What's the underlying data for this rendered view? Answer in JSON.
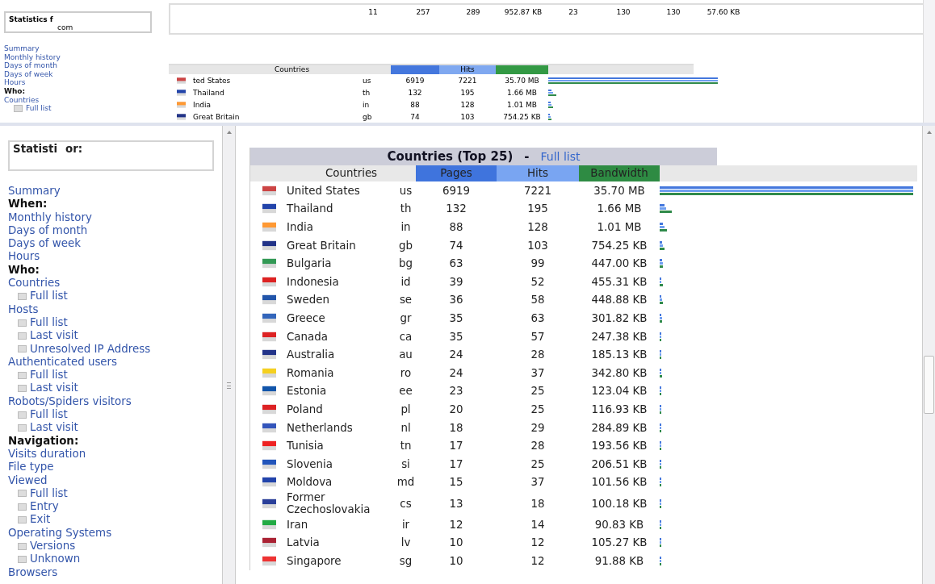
{
  "top_frame": {
    "stats_box": {
      "title": "Statistics f",
      "domain": "com"
    },
    "nav": [
      {
        "kind": "link",
        "label": "Summary"
      },
      {
        "kind": "link",
        "label": "Monthly history"
      },
      {
        "kind": "link",
        "label": "Days of month"
      },
      {
        "kind": "link",
        "label": "Days of week"
      },
      {
        "kind": "link",
        "label": "Hours"
      },
      {
        "kind": "heading",
        "label": "Who:"
      },
      {
        "kind": "link",
        "label": "Countries"
      },
      {
        "kind": "sub",
        "label": "Full list"
      }
    ],
    "summary_row": [
      "11",
      "257",
      "289",
      "952.87 KB",
      "23",
      "130",
      "130",
      "57.60 KB"
    ],
    "table": {
      "columns": [
        "Countries",
        "Hits"
      ],
      "rows": [
        {
          "name": "ted States",
          "code": "us",
          "pages": "6919",
          "hits": "7221",
          "bandwidth": "35.70 MB",
          "color": "#cc4444"
        },
        {
          "name": "Thailand",
          "code": "th",
          "pages": "132",
          "hits": "195",
          "bandwidth": "1.66 MB",
          "color": "#2244aa"
        },
        {
          "name": "India",
          "code": "in",
          "pages": "88",
          "hits": "128",
          "bandwidth": "1.01 MB",
          "color": "#ff9933"
        },
        {
          "name": "Great Britain",
          "code": "gb",
          "pages": "74",
          "hits": "103",
          "bandwidth": "754.25 KB",
          "color": "#223388"
        }
      ]
    }
  },
  "bottom_frame": {
    "stats_box": {
      "title": "Statisti",
      "title_end": "or:"
    },
    "nav": [
      {
        "kind": "link",
        "label": "Summary"
      },
      {
        "kind": "heading",
        "label": "When:"
      },
      {
        "kind": "link",
        "label": "Monthly history"
      },
      {
        "kind": "link",
        "label": "Days of month"
      },
      {
        "kind": "link",
        "label": "Days of week"
      },
      {
        "kind": "link",
        "label": "Hours"
      },
      {
        "kind": "heading",
        "label": "Who:"
      },
      {
        "kind": "link",
        "label": "Countries"
      },
      {
        "kind": "sub",
        "label": "Full list"
      },
      {
        "kind": "link",
        "label": "Hosts"
      },
      {
        "kind": "sub",
        "label": "Full list"
      },
      {
        "kind": "sub",
        "label": "Last visit"
      },
      {
        "kind": "sub",
        "label": "Unresolved IP Address"
      },
      {
        "kind": "link",
        "label": "Authenticated users"
      },
      {
        "kind": "sub",
        "label": "Full list"
      },
      {
        "kind": "sub",
        "label": "Last visit"
      },
      {
        "kind": "link",
        "label": "Robots/Spiders visitors"
      },
      {
        "kind": "sub",
        "label": "Full list"
      },
      {
        "kind": "sub",
        "label": "Last visit"
      },
      {
        "kind": "heading",
        "label": "Navigation:"
      },
      {
        "kind": "link",
        "label": "Visits duration"
      },
      {
        "kind": "link",
        "label": "File type"
      },
      {
        "kind": "link",
        "label": "Viewed"
      },
      {
        "kind": "sub",
        "label": "Full list"
      },
      {
        "kind": "sub",
        "label": "Entry"
      },
      {
        "kind": "sub",
        "label": "Exit"
      },
      {
        "kind": "link",
        "label": "Operating Systems"
      },
      {
        "kind": "sub",
        "label": "Versions"
      },
      {
        "kind": "sub",
        "label": "Unknown"
      },
      {
        "kind": "link",
        "label": "Browsers"
      }
    ],
    "table": {
      "title": "Countries (Top 25)",
      "separator": "-",
      "title_link": "Full list",
      "columns": [
        "Countries",
        "Pages",
        "Hits",
        "Bandwidth"
      ],
      "rows": [
        {
          "name": "United States",
          "code": "us",
          "pages": "6919",
          "hits": "7221",
          "bandwidth": "35.70 MB",
          "color": "#cc4444"
        },
        {
          "name": "Thailand",
          "code": "th",
          "pages": "132",
          "hits": "195",
          "bandwidth": "1.66 MB",
          "color": "#2244aa"
        },
        {
          "name": "India",
          "code": "in",
          "pages": "88",
          "hits": "128",
          "bandwidth": "1.01 MB",
          "color": "#ff9933"
        },
        {
          "name": "Great Britain",
          "code": "gb",
          "pages": "74",
          "hits": "103",
          "bandwidth": "754.25 KB",
          "color": "#223388"
        },
        {
          "name": "Bulgaria",
          "code": "bg",
          "pages": "63",
          "hits": "99",
          "bandwidth": "447.00 KB",
          "color": "#339955"
        },
        {
          "name": "Indonesia",
          "code": "id",
          "pages": "39",
          "hits": "52",
          "bandwidth": "455.31 KB",
          "color": "#dd2222"
        },
        {
          "name": "Sweden",
          "code": "se",
          "pages": "36",
          "hits": "58",
          "bandwidth": "448.88 KB",
          "color": "#2255aa"
        },
        {
          "name": "Greece",
          "code": "gr",
          "pages": "35",
          "hits": "63",
          "bandwidth": "301.82 KB",
          "color": "#3366bb"
        },
        {
          "name": "Canada",
          "code": "ca",
          "pages": "35",
          "hits": "57",
          "bandwidth": "247.38 KB",
          "color": "#dd2223"
        },
        {
          "name": "Australia",
          "code": "au",
          "pages": "24",
          "hits": "28",
          "bandwidth": "185.13 KB",
          "color": "#223389"
        },
        {
          "name": "Romania",
          "code": "ro",
          "pages": "24",
          "hits": "37",
          "bandwidth": "342.80 KB",
          "color": "#f5d020"
        },
        {
          "name": "Estonia",
          "code": "ee",
          "pages": "23",
          "hits": "25",
          "bandwidth": "123.04 KB",
          "color": "#1155aa"
        },
        {
          "name": "Poland",
          "code": "pl",
          "pages": "20",
          "hits": "25",
          "bandwidth": "116.93 KB",
          "color": "#dd2224"
        },
        {
          "name": "Netherlands",
          "code": "nl",
          "pages": "18",
          "hits": "29",
          "bandwidth": "284.89 KB",
          "color": "#3355bb"
        },
        {
          "name": "Tunisia",
          "code": "tn",
          "pages": "17",
          "hits": "28",
          "bandwidth": "193.56 KB",
          "color": "#ee2222"
        },
        {
          "name": "Slovenia",
          "code": "si",
          "pages": "17",
          "hits": "25",
          "bandwidth": "206.51 KB",
          "color": "#2255bb"
        },
        {
          "name": "Moldova",
          "code": "md",
          "pages": "15",
          "hits": "37",
          "bandwidth": "101.56 KB",
          "color": "#2244ab"
        },
        {
          "name": "Former Czechoslovakia",
          "code": "cs",
          "pages": "13",
          "hits": "18",
          "bandwidth": "100.18 KB",
          "color": "#2a3f99"
        },
        {
          "name": "Iran",
          "code": "ir",
          "pages": "12",
          "hits": "14",
          "bandwidth": "90.83 KB",
          "color": "#22aa44"
        },
        {
          "name": "Latvia",
          "code": "lv",
          "pages": "10",
          "hits": "12",
          "bandwidth": "105.27 KB",
          "color": "#aa2233"
        },
        {
          "name": "Singapore",
          "code": "sg",
          "pages": "10",
          "hits": "12",
          "bandwidth": "91.88 KB",
          "color": "#ee3333"
        }
      ]
    }
  }
}
